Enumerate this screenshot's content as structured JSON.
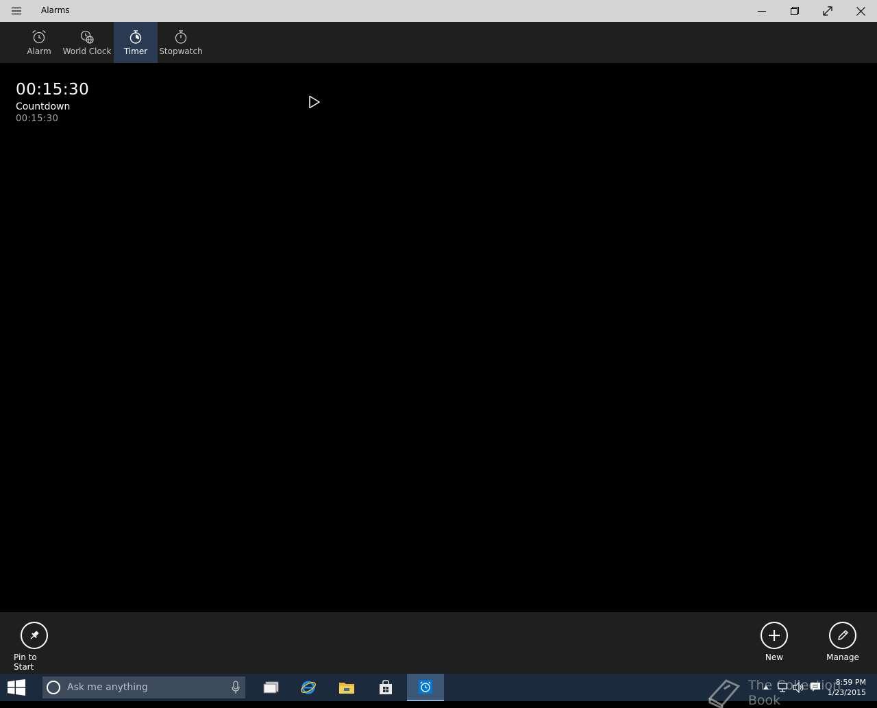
{
  "titlebar": {
    "title": "Alarms"
  },
  "tabs": [
    {
      "label": "Alarm",
      "icon": "alarm-clock-icon"
    },
    {
      "label": "World Clock",
      "icon": "world-clock-icon"
    },
    {
      "label": "Timer",
      "icon": "timer-icon",
      "active": true
    },
    {
      "label": "Stopwatch",
      "icon": "stopwatch-icon"
    }
  ],
  "timer": {
    "time": "00:15:30",
    "name": "Countdown",
    "duration": "00:15:30"
  },
  "appbar": {
    "pin_label": "Pin to Start",
    "new_label": "New",
    "manage_label": "Manage"
  },
  "taskbar": {
    "search_placeholder": "Ask me anything",
    "time": "8:59 PM",
    "date": "1/23/2015"
  },
  "watermark": {
    "text": "The Collection Book"
  },
  "colors": {
    "titlebar": "#d4d4d4",
    "tabs_bg": "#1f1f1f",
    "active_tab": "#2a3a52",
    "taskbar": "#1b2a3d",
    "accent": "#0078d7"
  }
}
